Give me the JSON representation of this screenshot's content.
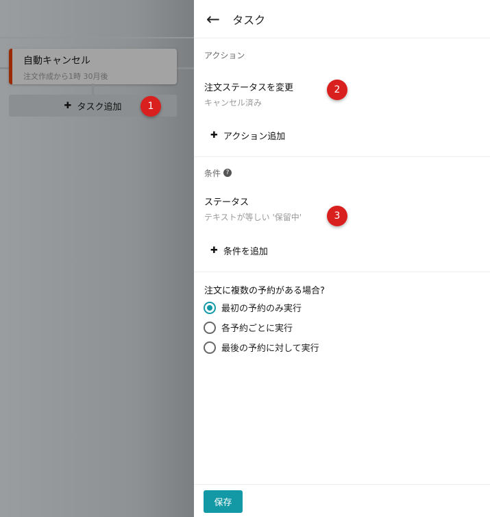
{
  "left": {
    "card_title": "自動キャンセル",
    "card_subtitle": "注文作成から1時 30月後",
    "add_task": "タスク追加"
  },
  "badges": [
    "1",
    "2",
    "3"
  ],
  "panel": {
    "title": "タスク",
    "actions": {
      "label": "アクション",
      "item_title": "注文ステータスを変更",
      "item_value": "キャンセル済み",
      "add": "アクション追加"
    },
    "conditions": {
      "label": "条件",
      "item_title": "ステータス",
      "item_value": "テキストが等しい '保留中'",
      "add": "条件を追加"
    },
    "multi": {
      "question": "注文に複数の予約がある場合?",
      "options": [
        "最初の予約のみ実行",
        "各予約ごとに実行",
        "最後の予約に対して実行"
      ],
      "selected": 0
    },
    "save": "保存"
  },
  "colors": {
    "accent": "#1399a6",
    "badge": "#d9201f",
    "card_border": "#9a2a05"
  }
}
